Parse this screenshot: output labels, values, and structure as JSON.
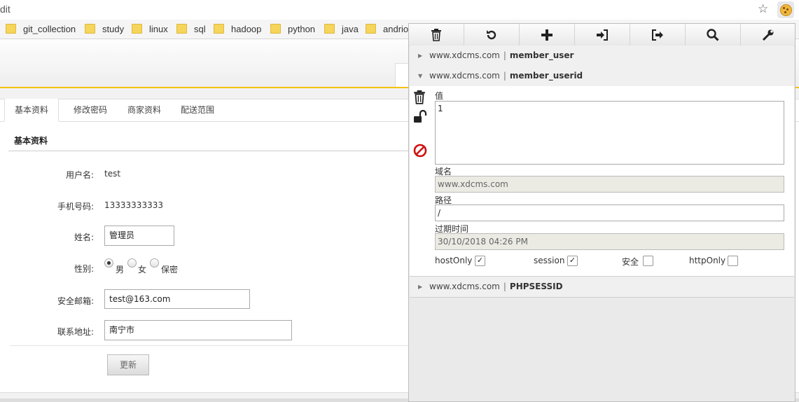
{
  "browser": {
    "address_text": "dit",
    "bookmarks": [
      "git_collection",
      "study",
      "linux",
      "sql",
      "hadoop",
      "python",
      "java",
      "andrio"
    ]
  },
  "page": {
    "tabs": [
      "基本资料",
      "修改密码",
      "商家资料",
      "配送范围"
    ],
    "section_title": "基本资料",
    "fields": {
      "username_label": "用户名:",
      "username_value": "test",
      "phone_label": "手机号码:",
      "phone_value": "13333333333",
      "name_label": "姓名:",
      "name_value": "管理员",
      "gender_label": "性别:",
      "gender_options": [
        "男",
        "女",
        "保密"
      ],
      "email_label": "安全邮箱:",
      "email_value": "test@163.com",
      "address_label": "联系地址:",
      "address_value": "南宁市"
    },
    "update_button": "更新"
  },
  "cookie_editor": {
    "toolbar_icons": [
      "trash-icon",
      "refresh-icon",
      "plus-icon",
      "import-icon",
      "export-icon",
      "search-icon",
      "wrench-icon"
    ],
    "cookies": [
      {
        "domain": "www.xdcms.com",
        "sep": "|",
        "name": "member_user"
      },
      {
        "domain": "www.xdcms.com",
        "sep": "|",
        "name": "member_userid"
      },
      {
        "domain": "www.xdcms.com",
        "sep": "|",
        "name": "PHPSESSID"
      }
    ],
    "detail": {
      "value_label": "值",
      "value": "1",
      "domain_label": "域名",
      "domain_value": "www.xdcms.com",
      "path_label": "路径",
      "path_value": "/",
      "expiry_label": "过期时间",
      "expiry_value": "30/10/2018 04:26 PM",
      "flags": {
        "host_only_label": "hostOnly",
        "session_label": "session",
        "secure_label": "安全",
        "http_only_label": "httpOnly",
        "checkmark": "✓"
      }
    }
  }
}
